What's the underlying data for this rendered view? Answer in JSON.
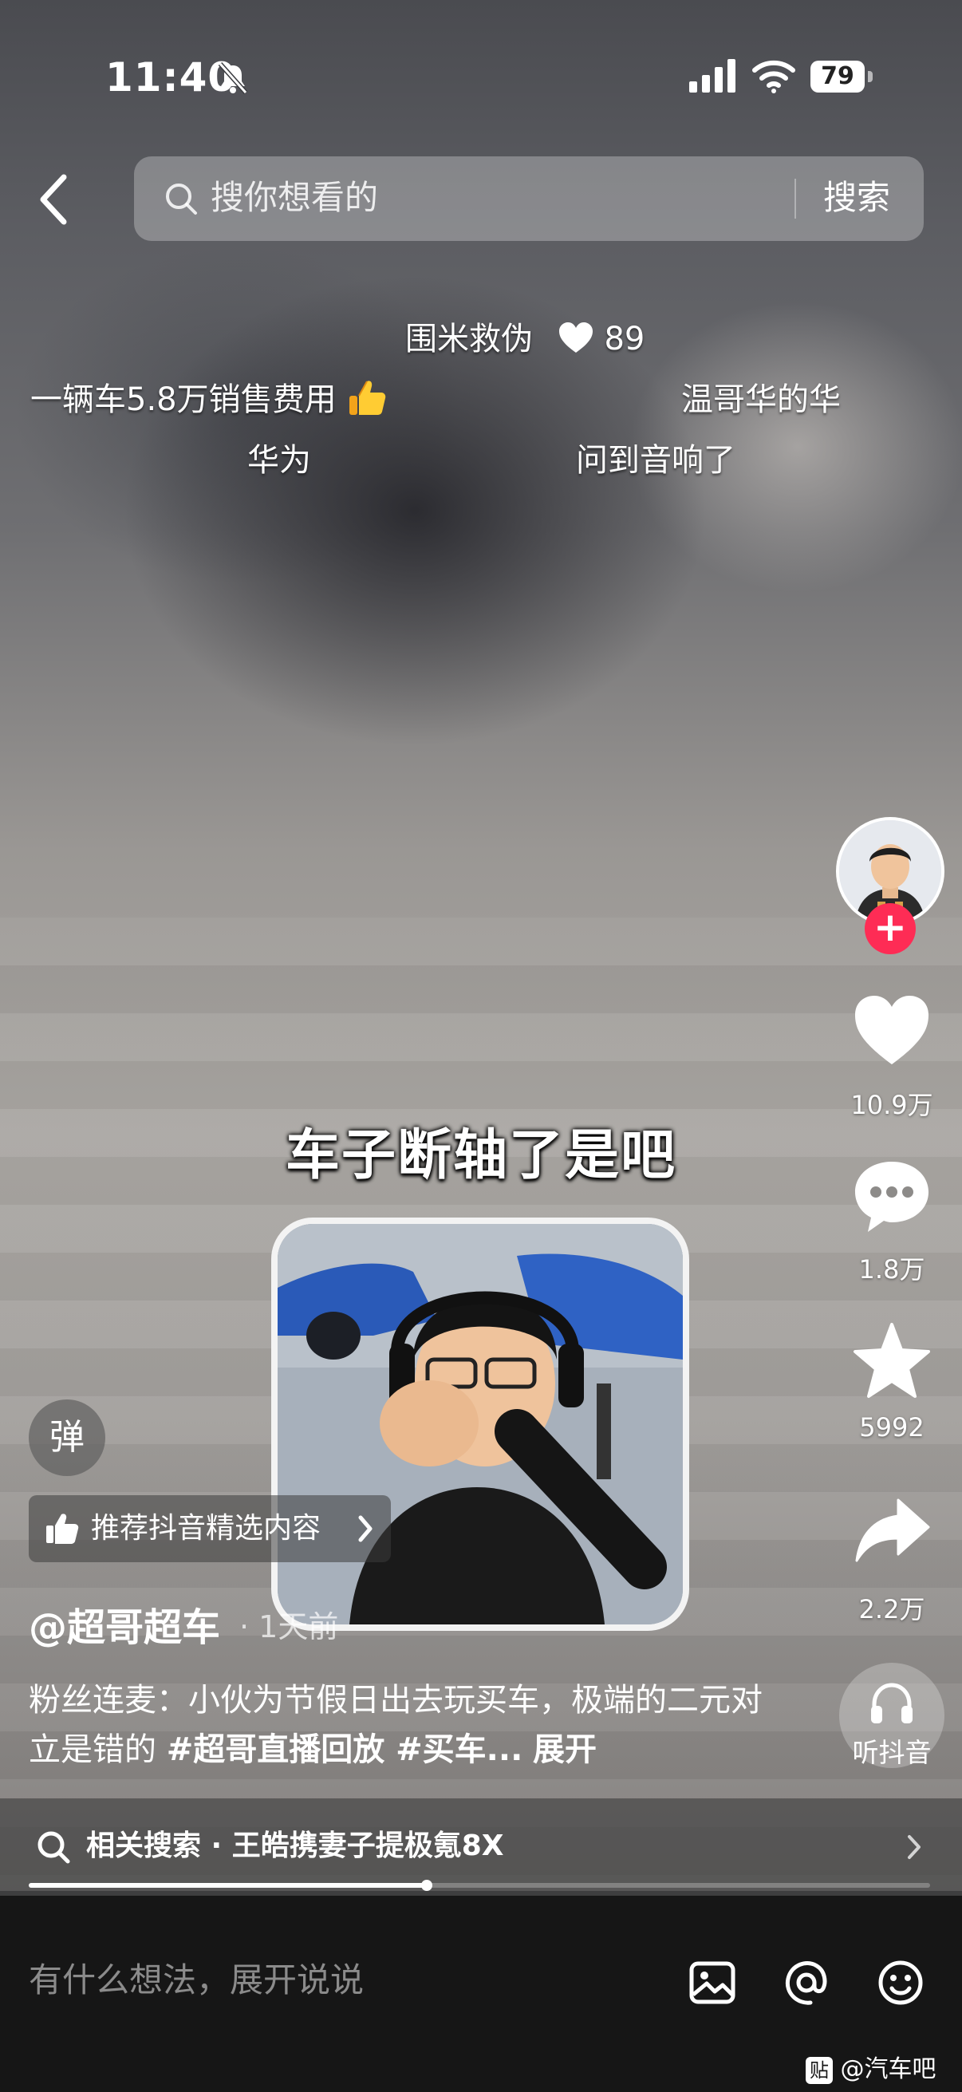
{
  "status_bar": {
    "time": "11:40",
    "battery": "79"
  },
  "search": {
    "placeholder": "搜你想看的",
    "button": "搜索"
  },
  "danmaku": [
    {
      "text": "围米救伪",
      "likes": "89"
    },
    {
      "text": "一辆车5.8万销售费用"
    },
    {
      "text": "温哥华的华"
    },
    {
      "text": "华为"
    },
    {
      "text": "问到音响了"
    }
  ],
  "rail": {
    "likes": "10.9万",
    "comments": "1.8万",
    "favorites": "5992",
    "shares": "2.2万",
    "listen_label": "听抖音"
  },
  "video": {
    "caption": "车子断轴了是吧"
  },
  "overlay": {
    "danmaku_toggle": "弹",
    "recommend": "推荐抖音精选内容"
  },
  "post": {
    "author": "@超哥超车",
    "time": "· 1天前",
    "description": "粉丝连麦：小伙为节假日出去玩买车，极端的二元对立是错的",
    "tags": "#超哥直播回放 #买车...",
    "more": "展开"
  },
  "related_search": {
    "text": "相关搜索 · 王皓携妻子提极氪8X"
  },
  "progress": {
    "fraction": 0.442
  },
  "composer": {
    "placeholder": "有什么想法，展开说说"
  },
  "watermark": {
    "badge": "贴",
    "text": "@汽车吧"
  }
}
